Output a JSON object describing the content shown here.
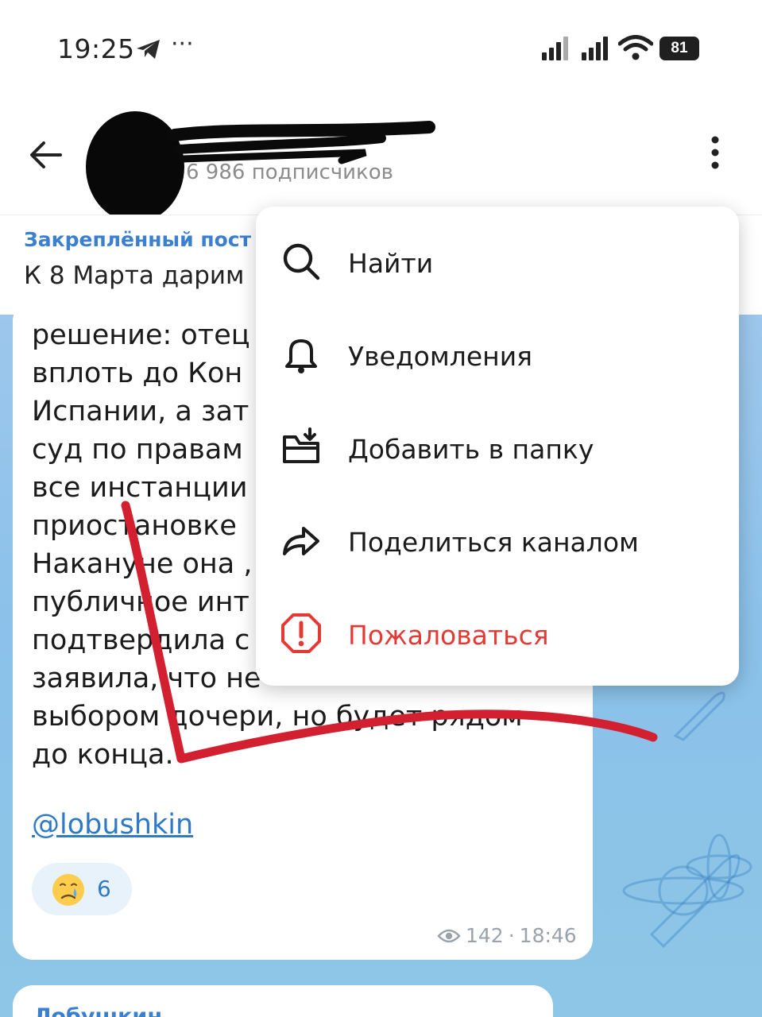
{
  "status_bar": {
    "time": "19:25",
    "dots": "···",
    "battery": "81",
    "icons": [
      "telegram-icon",
      "signal-icon",
      "signal-icon",
      "wifi-icon",
      "battery-icon"
    ]
  },
  "header": {
    "subscribers": "6 986 подписчиков",
    "icons": [
      "back-arrow-icon",
      "kebab-menu-icon"
    ]
  },
  "pinned": {
    "title": "Закреплённый пост",
    "text": "К 8 Марта дарим"
  },
  "message": {
    "lines": [
      "решение: отец",
      "вплоть до Кон",
      "Испании, а зат",
      "суд по правам",
      "все инстанции",
      "приостановке",
      "Накануне она ,",
      "публичное инт",
      "подтвердила с",
      "заявила, что не",
      "выбором дочери, но будет рядом",
      "до конца."
    ],
    "mention": "@lobushkin",
    "reaction": {
      "emoji": "crying-face-icon",
      "count": "6"
    },
    "views": "142",
    "separator": "·",
    "time": "18:46"
  },
  "next_message": {
    "author": "Лобушкин"
  },
  "menu": {
    "items": [
      {
        "label": "Найти",
        "icon": "search-icon"
      },
      {
        "label": "Уведомления",
        "icon": "bell-icon"
      },
      {
        "label": "Добавить в папку",
        "icon": "folder-add-icon"
      },
      {
        "label": "Поделиться каналом",
        "icon": "share-icon"
      },
      {
        "label": "Пожаловаться",
        "icon": "report-icon"
      }
    ]
  },
  "colors": {
    "accent": "#3a7fd0",
    "danger": "#e53935",
    "chat_background": "#8bc1ea",
    "annotation_red": "#d32030"
  }
}
